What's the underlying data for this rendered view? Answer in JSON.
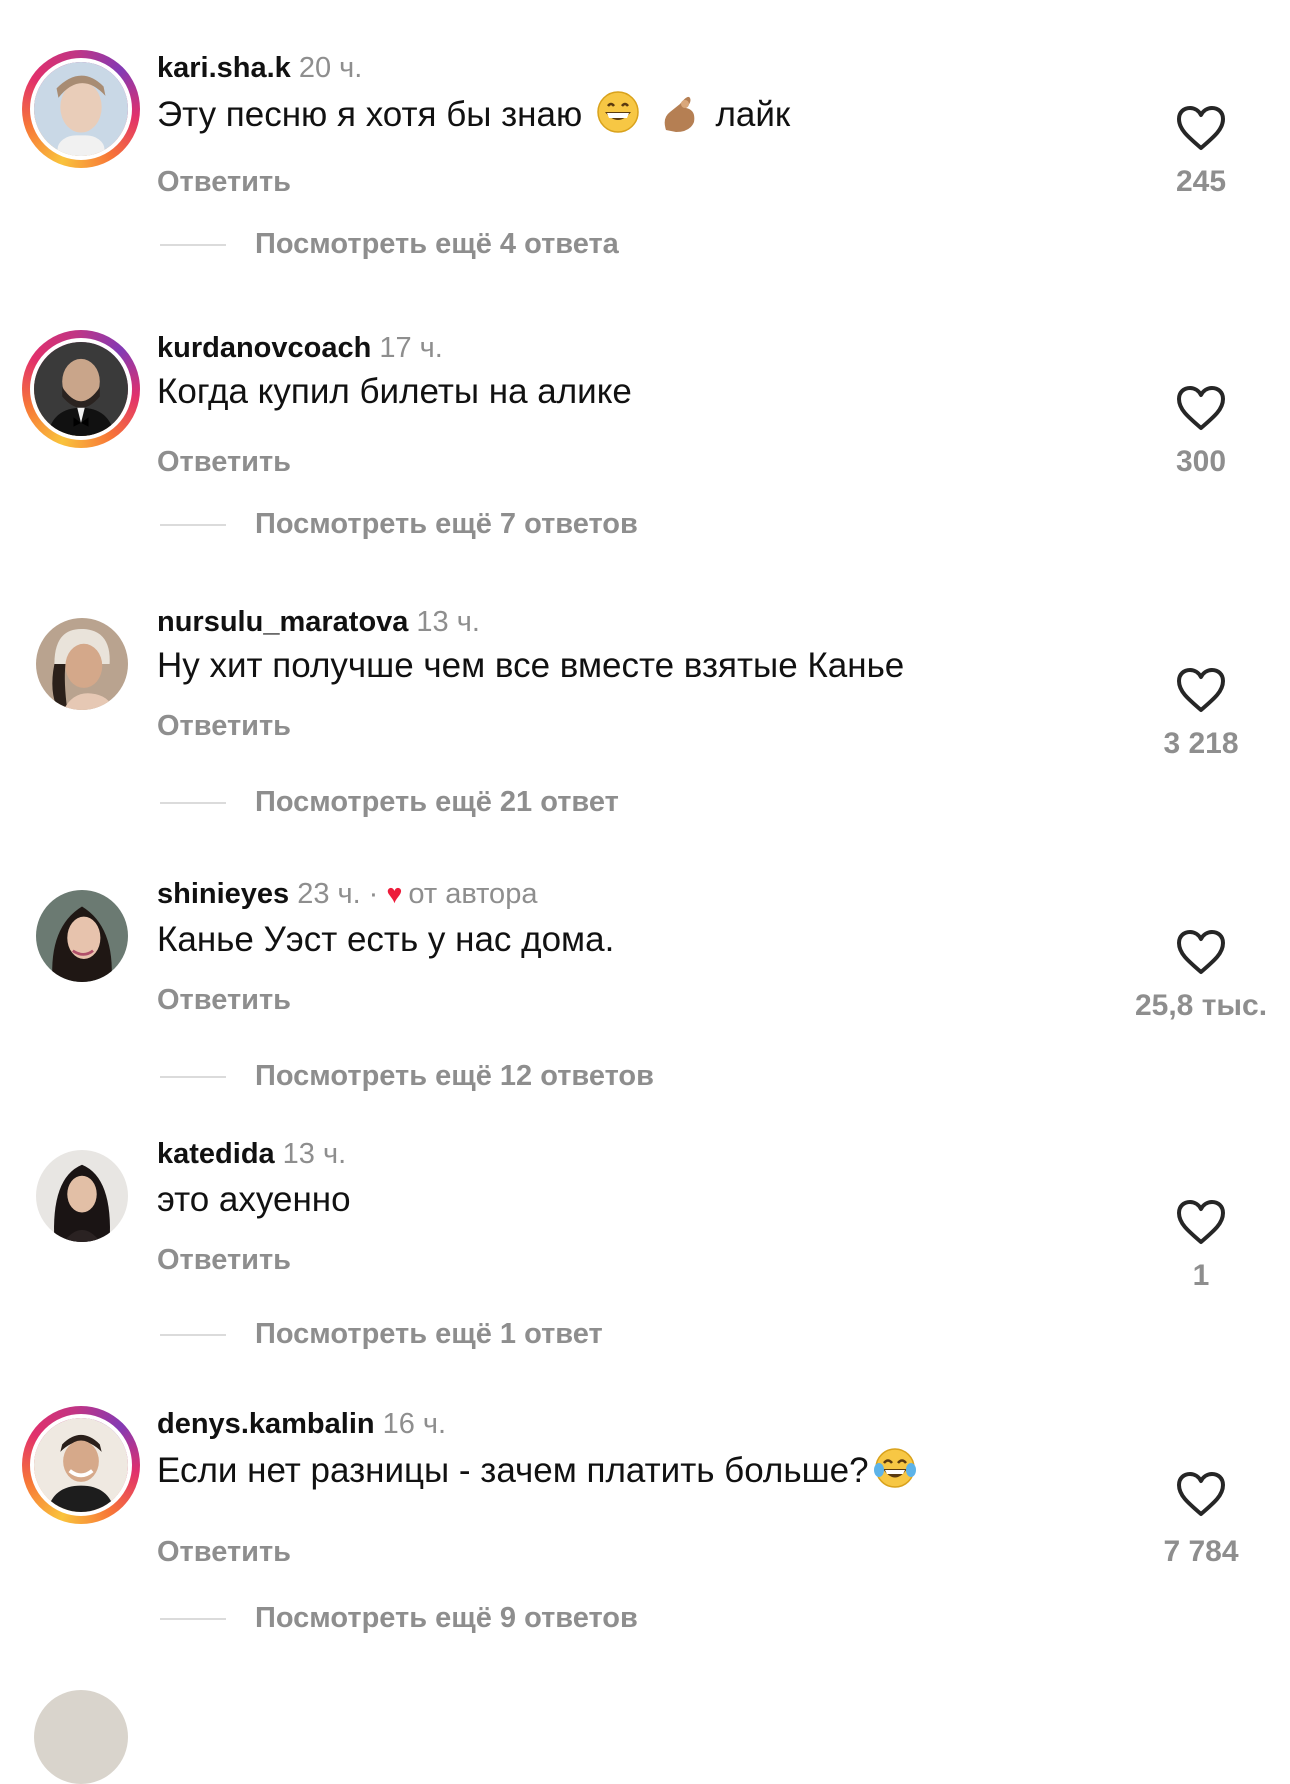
{
  "comments": [
    {
      "username": "kari.sha.k",
      "time": "20 ч.",
      "text": "Эту песню я хотя бы знаю",
      "text_after": "лайк",
      "reply": "Ответить",
      "likes": "245",
      "view_more": "Посмотреть ещё 4 ответа"
    },
    {
      "username": "kurdanovcoach",
      "time": "17 ч.",
      "text": "Когда купил билеты на алике",
      "reply": "Ответить",
      "likes": "300",
      "view_more": "Посмотреть ещё 7 ответов"
    },
    {
      "username": "nursulu_maratova",
      "time": "13 ч.",
      "text": "Ну хит получше чем все вместе взятые Канье",
      "reply": "Ответить",
      "likes": "3 218",
      "view_more": "Посмотреть ещё 21 ответ"
    },
    {
      "username": "shinieyes",
      "time": "23 ч.",
      "dot": "·",
      "author_heart": "♥",
      "author_label": "от автора",
      "text": "Канье Уэст есть у нас дома.",
      "reply": "Ответить",
      "likes": "25,8 тыс.",
      "view_more": "Посмотреть ещё 12 ответов"
    },
    {
      "username": "katedida",
      "time": "13 ч.",
      "text": "это ахуенно",
      "reply": "Ответить",
      "likes": "1",
      "view_more": "Посмотреть ещё 1 ответ"
    },
    {
      "username": "denys.kambalin",
      "time": "16 ч.",
      "text": "Если нет разницы - зачем платить больше?",
      "reply": "Ответить",
      "likes": "7 784",
      "view_more": "Посмотреть ещё 9 ответов"
    }
  ],
  "icons": {
    "like": "heart-outline-icon",
    "author_like": "heart-filled-icon"
  },
  "colors": {
    "author_heart": "#ed1c3b",
    "secondary_text": "#8e8e8e"
  }
}
